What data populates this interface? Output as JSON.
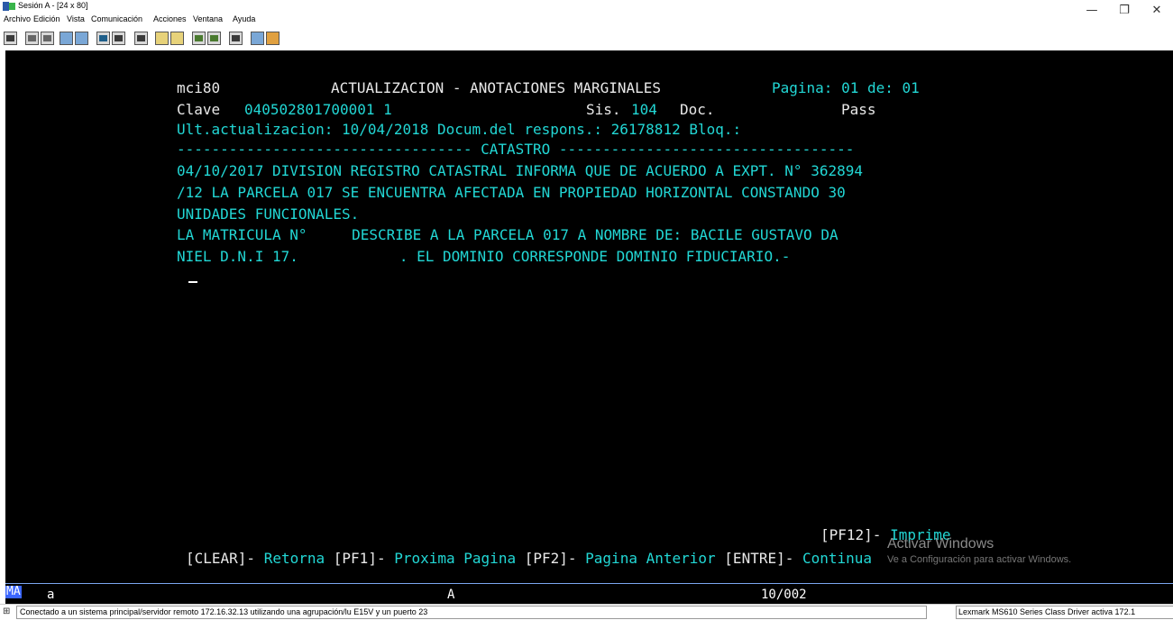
{
  "window": {
    "title": "Sesión A - [24 x 80]",
    "minimize": "—",
    "restore": "❐",
    "close": "✕"
  },
  "menu": [
    "Archivo",
    "Edición",
    "Vista",
    "Comunicación",
    "Acciones",
    "Ventana",
    "Ayuda"
  ],
  "screen": {
    "program": "mci80",
    "heading": "ACTUALIZACION - ANOTACIONES MARGINALES",
    "pagina_label": "Pagina:",
    "pagina_actual": "01",
    "pagina_de": "de:",
    "pagina_total": "01",
    "clave_label": "Clave",
    "clave_value": "040502801700001 1",
    "sis_label": "Sis.",
    "sis_value": "104",
    "doc_label": "Doc.",
    "pass_label": "Pass",
    "ult_line": "Ult.actualizacion: 10/04/2018 Docum.del respons.: 26178812 Bloq.:",
    "separator": "---------------------------------- CATASTRO ----------------------------------",
    "text_line1": "04/10/2017 DIVISION REGISTRO CATASTRAL INFORMA QUE DE ACUERDO A EXPT. N° 362894",
    "text_line2": "/12 LA PARCELA 017 SE ENCUENTRA AFECTADA EN PROPIEDAD HORIZONTAL CONSTANDO 30",
    "text_line3": "UNIDADES FUNCIONALES.",
    "text_line4a": "LA MATRICULA N°",
    "text_line4b": "DESCRIBE A LA PARCELA 017 A NOMBRE DE: BACILE GUSTAVO DA",
    "text_line5a": "NIEL D.N.I 17.",
    "text_line5b": ". EL DOMINIO CORRESPONDE DOMINIO FIDUCIARIO.-",
    "pf12_key": "[PF12]-",
    "pf12_label": "Imprime",
    "clear_key": "[CLEAR]-",
    "clear_label": "Retorna",
    "pf1_key": "[PF1]-",
    "pf1_label": "Proxima Pagina",
    "pf2_key": "[PF2]-",
    "pf2_label": "Pagina Anterior",
    "enter_key": "[ENTRE]-",
    "enter_label": "Continua"
  },
  "watermark": {
    "line1": "Activar Windows",
    "line2": "Ve a Configuración para activar Windows."
  },
  "oia": {
    "ma": "MA",
    "session": "a",
    "mode": "A",
    "cursor_pos": "10/002"
  },
  "status": {
    "connection": "Conectado a un sistema principal/servidor remoto 172.16.32.13 utilizando una agrupación/lu E15V y un puerto 23",
    "printer": "Lexmark MS610 Series Class Driver activa 172.1"
  }
}
